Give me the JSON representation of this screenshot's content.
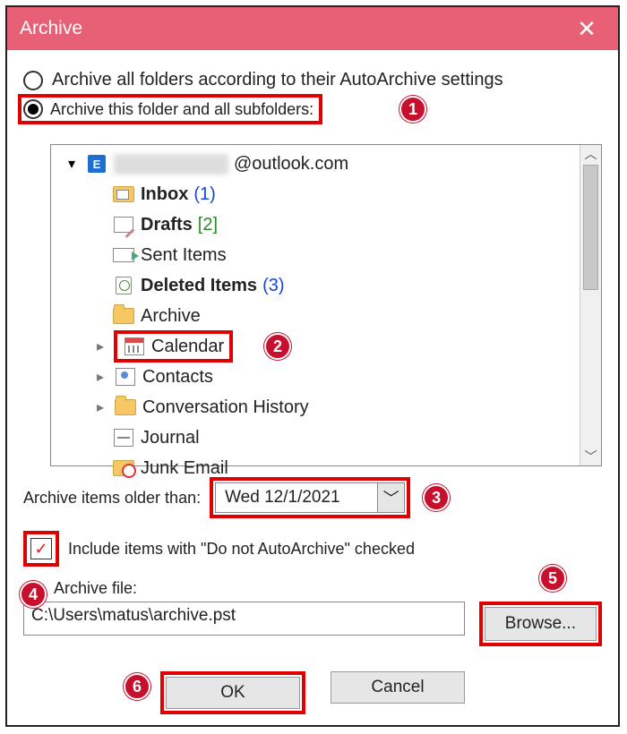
{
  "title": "Archive",
  "radios": {
    "all": "Archive all folders according to their AutoArchive settings",
    "this": "Archive this folder and all subfolders:"
  },
  "account_suffix": "@outlook.com",
  "tree": {
    "inbox": "Inbox",
    "inbox_count": "(1)",
    "drafts": "Drafts",
    "drafts_count": "[2]",
    "sent": "Sent Items",
    "deleted": "Deleted Items",
    "deleted_count": "(3)",
    "archive": "Archive",
    "calendar": "Calendar",
    "contacts": "Contacts",
    "conv": "Conversation History",
    "journal": "Journal",
    "junk": "Junk Email"
  },
  "older_label": "Archive items older than:",
  "older_value": "Wed 12/1/2021",
  "include_label": "Include items with \"Do not AutoArchive\" checked",
  "file_label": "Archive file:",
  "file_value": "C:\\Users\\matus\\archive.pst",
  "browse": "Browse...",
  "ok": "OK",
  "cancel": "Cancel",
  "badges": {
    "b1": "1",
    "b2": "2",
    "b3": "3",
    "b4": "4",
    "b5": "5",
    "b6": "6"
  }
}
